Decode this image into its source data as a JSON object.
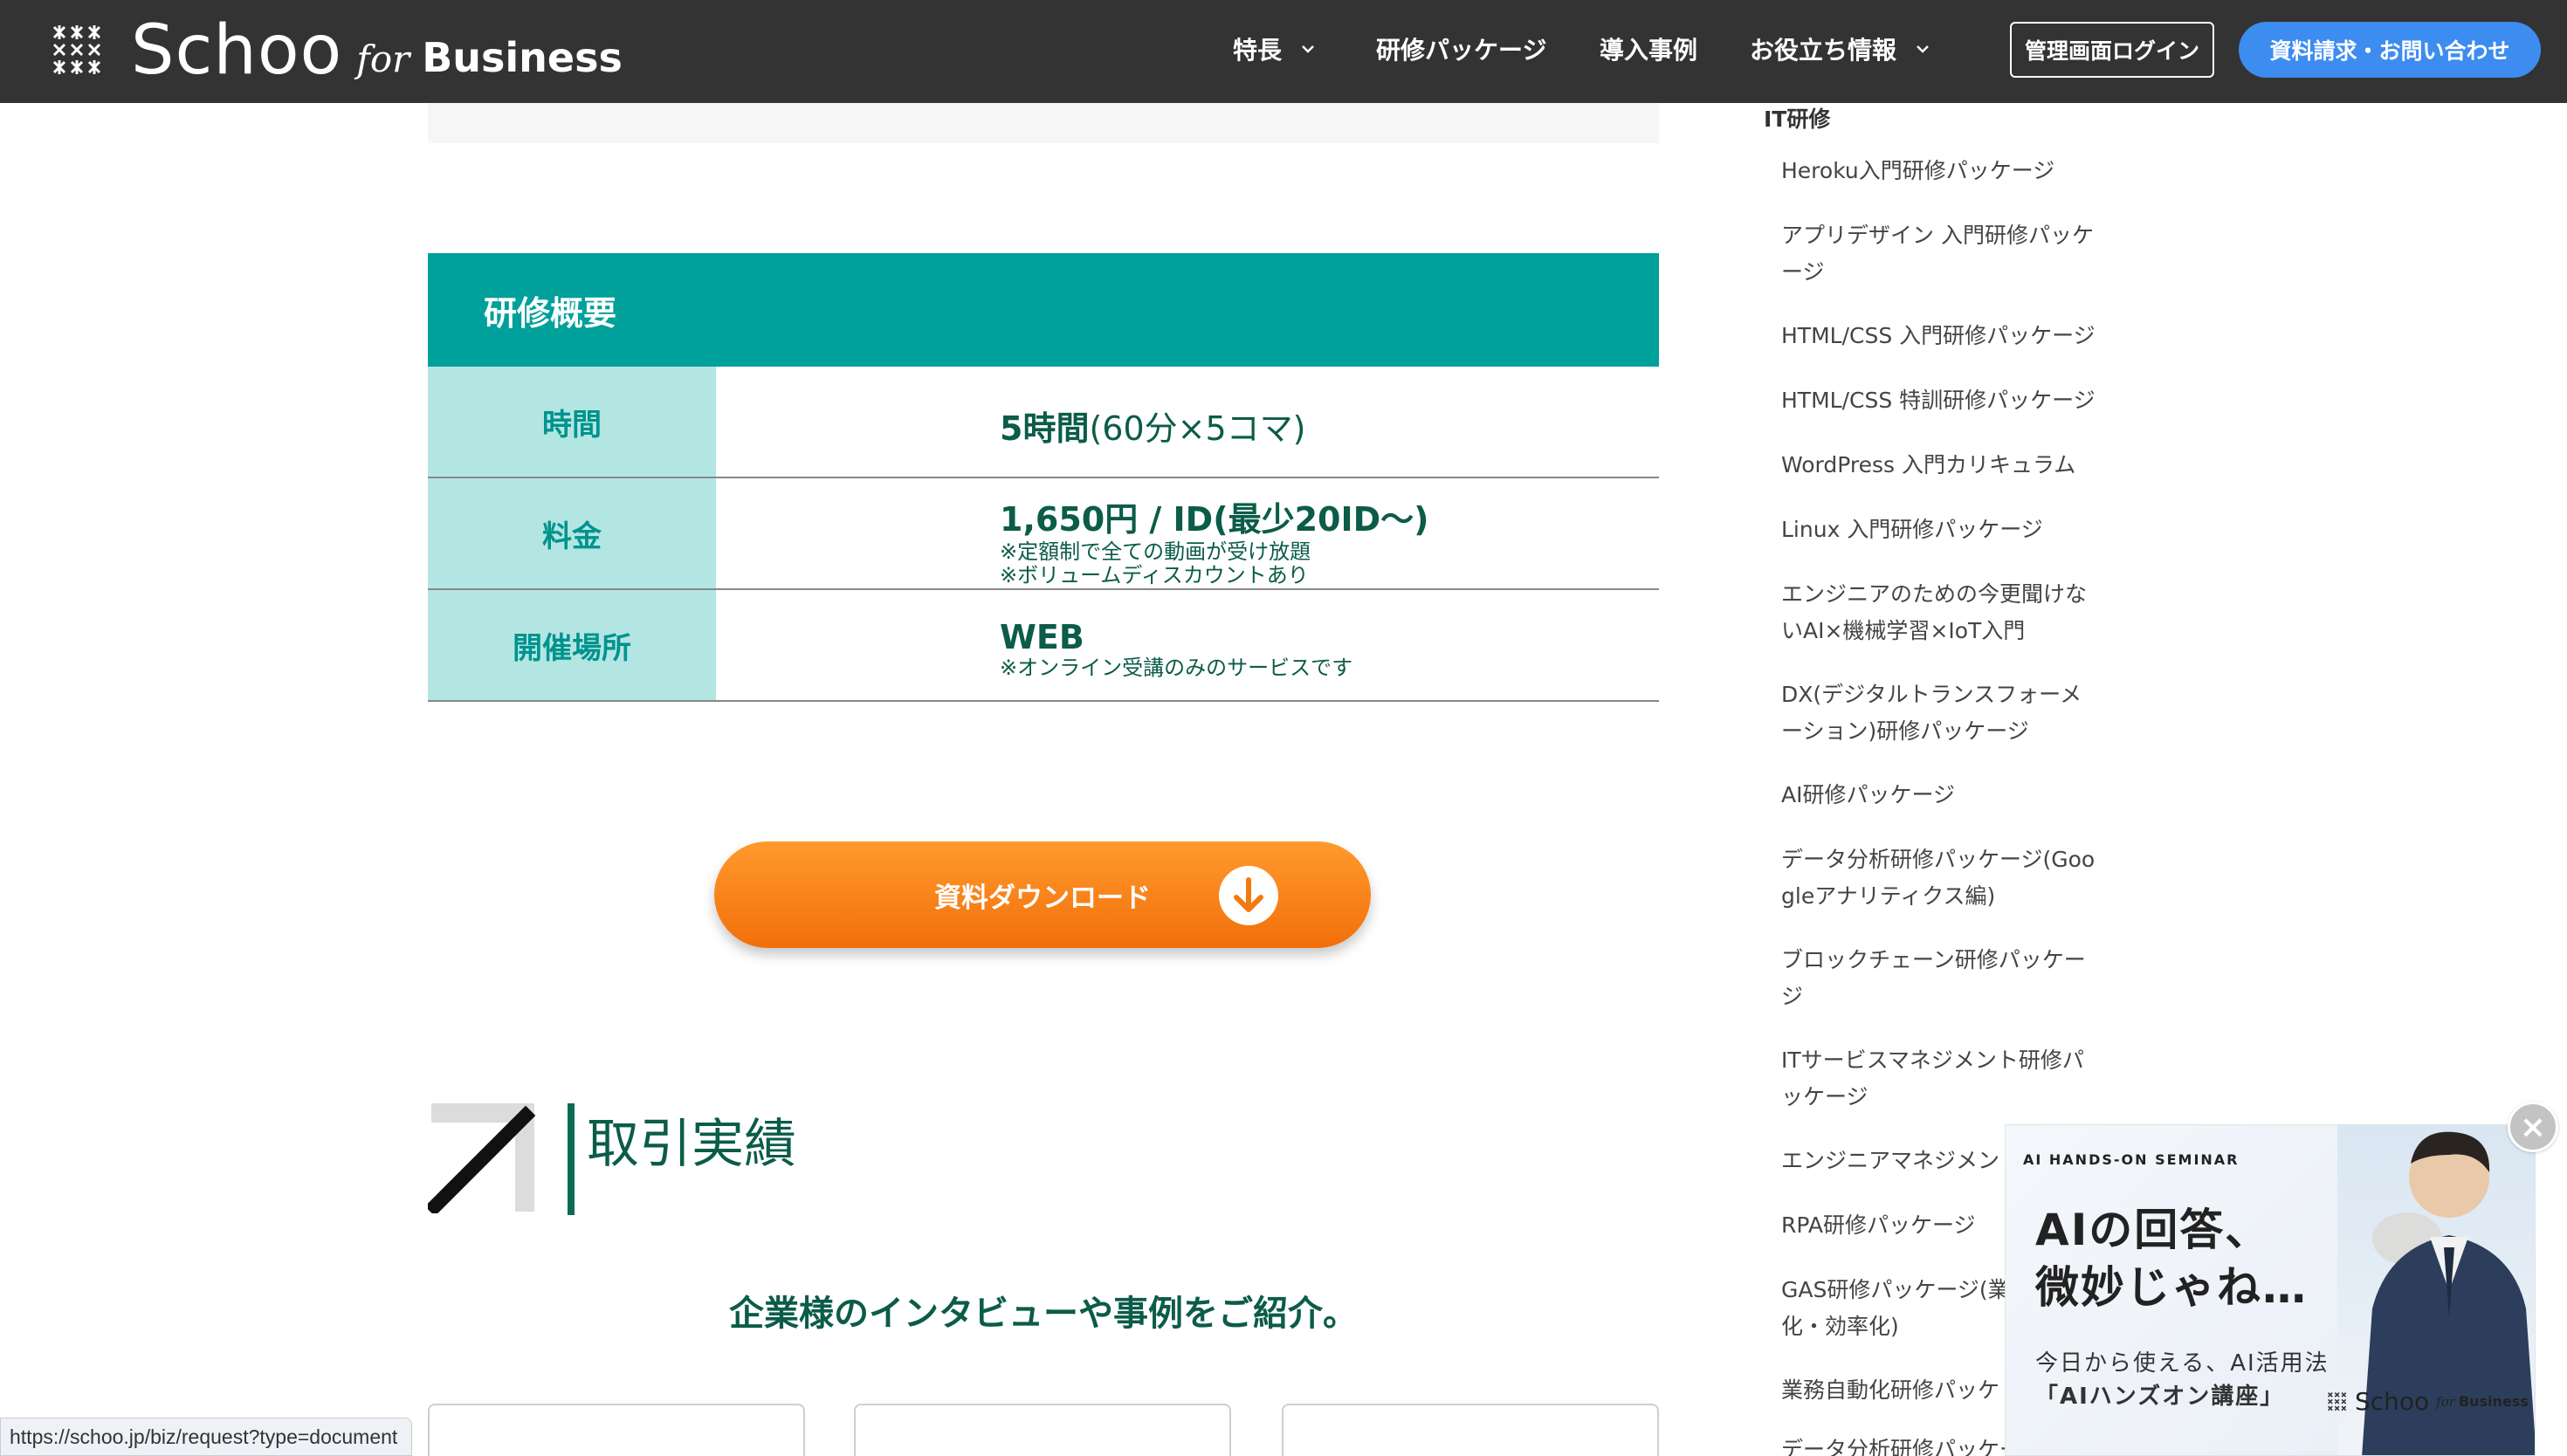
{
  "header": {
    "logo_main": "Schoo",
    "logo_for": "for",
    "logo_business": "Business",
    "nav": [
      {
        "label": "特長",
        "has_dropdown": true
      },
      {
        "label": "研修パッケージ",
        "has_dropdown": false
      },
      {
        "label": "導入事例",
        "has_dropdown": false
      },
      {
        "label": "お役立ち情報",
        "has_dropdown": true
      }
    ],
    "login_label": "管理画面ログイン",
    "contact_label": "資料請求・お問い合わせ"
  },
  "summary": {
    "title": "研修概要",
    "rows": [
      {
        "label": "時間",
        "value_bold": "5時間",
        "value_rest": "(60分×5コマ)",
        "notes": []
      },
      {
        "label": "料金",
        "value_bold": "1,650円 / ID(最少20ID〜)",
        "value_rest": "",
        "notes": [
          "※定額制で全ての動画が受け放題",
          "※ボリュームディスカウントあり"
        ]
      },
      {
        "label": "開催場所",
        "value_bold": "WEB",
        "value_rest": "",
        "notes": [
          "※オンライン受講のみのサービスです"
        ]
      }
    ]
  },
  "download_button": {
    "label": "資料ダウンロード"
  },
  "section": {
    "title": "取引実績",
    "subtitle": "企業様のインタビューや事例をご紹介。"
  },
  "sidebar": {
    "heading": "IT研修",
    "items": [
      {
        "lines": [
          "Heroku入門研修パッケージ"
        ]
      },
      {
        "lines": [
          "アプリデザイン 入門研修パッケ",
          "ージ"
        ]
      },
      {
        "lines": [
          "HTML/CSS 入門研修パッケージ"
        ]
      },
      {
        "lines": [
          "HTML/CSS 特訓研修パッケージ"
        ]
      },
      {
        "lines": [
          "WordPress 入門カリキュラム"
        ]
      },
      {
        "lines": [
          "Linux 入門研修パッケージ"
        ]
      },
      {
        "lines": [
          "エンジニアのための今更聞けな",
          "いAI×機械学習×IoT入門"
        ]
      },
      {
        "lines": [
          "DX(デジタルトランスフォーメ",
          "ーション)研修パッケージ"
        ]
      },
      {
        "lines": [
          "AI研修パッケージ"
        ]
      },
      {
        "lines": [
          "データ分析研修パッケージ(Goo",
          "gleアナリティクス編)"
        ]
      },
      {
        "lines": [
          "ブロックチェーン研修パッケー",
          "ジ"
        ]
      },
      {
        "lines": [
          "ITサービスマネジメント研修パ",
          "ッケージ"
        ]
      },
      {
        "lines": [
          "エンジニアマネジメン"
        ]
      },
      {
        "lines": [
          "RPA研修パッケージ"
        ]
      },
      {
        "lines": [
          "GAS研修パッケージ(業",
          "化・効率化)"
        ]
      },
      {
        "lines": [
          "業務自動化研修パッケ"
        ]
      },
      {
        "lines": [
          "データ分析研修パッケージ(エク"
        ]
      }
    ]
  },
  "popup": {
    "kicker": "AI HANDS-ON SEMINAR",
    "headline_1": "AIの回答、",
    "headline_2": "微妙じゃね…",
    "sub_1": "今日から使える、AI活用法",
    "sub_2": "「AIハンズオン講座」",
    "logo_main": "Schoo",
    "logo_for": "for",
    "logo_business": "Business",
    "close_label": "×"
  },
  "status_url": "https://schoo.jp/biz/request?type=document",
  "colors": {
    "header_bg": "#333333",
    "teal": "#00a09b",
    "teal_light": "#b3e6e3",
    "dark_green": "#0b5c48",
    "orange": "#f57f17",
    "blue": "#3d8cf0"
  }
}
